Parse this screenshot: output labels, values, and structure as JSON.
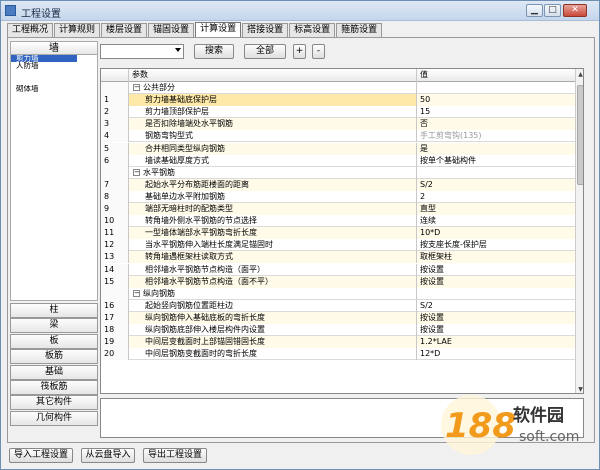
{
  "window": {
    "title": "工程设置",
    "controls": [
      "minimize-icon",
      "maximize-icon",
      "close-icon"
    ]
  },
  "tabs": [
    {
      "label": "工程概况",
      "active": false
    },
    {
      "label": "计算规则",
      "active": false
    },
    {
      "label": "楼层设置",
      "active": false
    },
    {
      "label": "锚固设置",
      "active": false
    },
    {
      "label": "计算设置",
      "active": true
    },
    {
      "label": "搭接设置",
      "active": false
    },
    {
      "label": "标高设置",
      "active": false
    },
    {
      "label": "箍筋设置",
      "active": false
    }
  ],
  "left_panel": {
    "header": "墙",
    "items": [
      "剪力墙",
      "人防墙",
      "",
      "",
      "砌体墙",
      "",
      "",
      "",
      "",
      "",
      "",
      "",
      "",
      "",
      "",
      "",
      "",
      ""
    ],
    "categories": [
      "柱",
      "梁",
      "板",
      "板筋",
      "基础",
      "筏板筋",
      "其它构件",
      "几何构件"
    ]
  },
  "search": {
    "dropdown_value": "",
    "search_button": "搜索",
    "all_button": "全部",
    "add_button": "+",
    "remove_button": "-"
  },
  "grid": {
    "headers": {
      "num": "",
      "param": "参数",
      "value": "值"
    },
    "rows": [
      {
        "type": "group",
        "name": "公共部分"
      },
      {
        "num": "1",
        "name": "剪力墙基础底保护层",
        "value": "50"
      },
      {
        "num": "2",
        "name": "剪力墙顶部保护层",
        "value": "15"
      },
      {
        "num": "3",
        "name": "是否扣除墙端处水平钢筋",
        "value": "否"
      },
      {
        "num": "4",
        "name": "钢筋弯钩型式",
        "value": "手工剪弯钩(135)",
        "muted": true
      },
      {
        "num": "5",
        "name": "合并相同类型纵向钢筋",
        "value": "是"
      },
      {
        "num": "6",
        "name": "墙读基础厚度方式",
        "value": "按单个基础构件"
      },
      {
        "type": "group",
        "name": "水平钢筋"
      },
      {
        "num": "7",
        "name": "起始水平分布筋距楼面的距离",
        "value": "S/2"
      },
      {
        "num": "8",
        "name": "基础单边水平附加钢筋",
        "value": "2"
      },
      {
        "num": "9",
        "name": "端部无暗柱时的配筋类型",
        "value": "直型"
      },
      {
        "num": "10",
        "name": "转角墙外侧水平钢筋的节点选择",
        "value": "连续"
      },
      {
        "num": "11",
        "name": "一型墙体端部水平钢筋弯折长度",
        "value": "10*D"
      },
      {
        "num": "12",
        "name": "当水平钢筋伸入端柱长度满足锚固时",
        "value": "按支座长度-保护层"
      },
      {
        "num": "13",
        "name": "转角墙遇框架柱读取方式",
        "value": "取框架柱"
      },
      {
        "num": "14",
        "name": "相邻墙水平钢筋节点构造（面平）",
        "value": "按设置"
      },
      {
        "num": "15",
        "name": "相邻墙水平钢筋节点构造（面不平）",
        "value": "按设置"
      },
      {
        "type": "group",
        "name": "纵向钢筋"
      },
      {
        "num": "16",
        "name": "起始竖向钢筋位置距柱边",
        "value": "S/2"
      },
      {
        "num": "17",
        "name": "纵向钢筋伸入基础底板的弯折长度",
        "value": "按设置"
      },
      {
        "num": "18",
        "name": "纵向钢筋底部伸入楼层构件内设置",
        "value": "按设置"
      },
      {
        "num": "19",
        "name": "中间层变截面时上部锚固错固长度",
        "value": "1.2*LAE"
      },
      {
        "num": "20",
        "name": "中间层钢筋变截面时的弯折长度",
        "value": "12*D"
      }
    ]
  },
  "footer": {
    "import_button": "导入工程设置",
    "cloud_button": "从云盘导入",
    "export_button": "导出工程设置"
  },
  "watermark": {
    "number": "188",
    "brand": "软件园",
    "domain": "soft.com"
  }
}
